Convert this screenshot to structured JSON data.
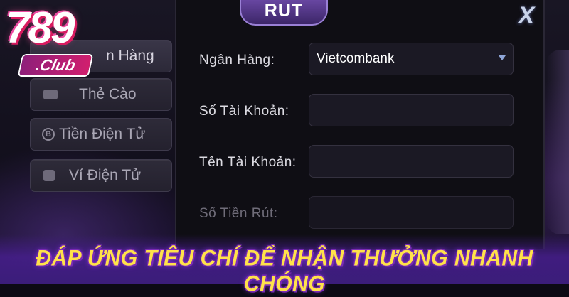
{
  "modal": {
    "title": "RUT",
    "close_label": "X",
    "bank_label": "Ngân Hàng:",
    "bank_value": "Vietcombank",
    "account_number_label": "Số Tài Khoản:",
    "account_number_value": "",
    "account_name_label": "Tên Tài Khoản:",
    "account_name_value": "",
    "amount_label": "Số Tiền Rút:",
    "amount_value": ""
  },
  "sidebar": {
    "items": [
      {
        "label": "n Hàng",
        "icon": "bank-icon"
      },
      {
        "label": "Thẻ Cào",
        "icon": "card-icon"
      },
      {
        "label": "Tiền Điện Tử",
        "icon": "bitcoin-icon",
        "glyph": "B"
      },
      {
        "label": "Ví Điện Tử",
        "icon": "wallet-icon"
      }
    ]
  },
  "logo": {
    "number": "789",
    "club": ".Club"
  },
  "headline": "ĐÁP ỨNG TIÊU CHÍ ĐỂ NHẬN THƯỞNG NHANH CHÓNG",
  "colors": {
    "headline": "#ffe24a",
    "tab_purple": "#6d4aa8",
    "logo_pink": "#d81b60"
  }
}
